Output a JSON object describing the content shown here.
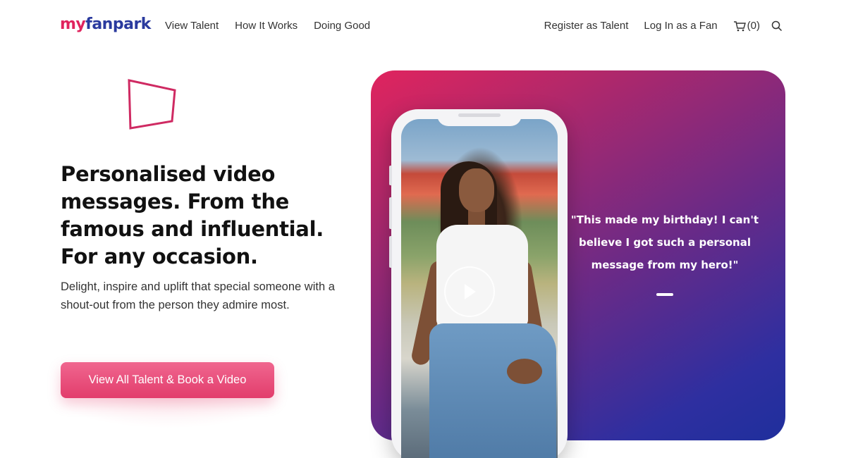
{
  "header": {
    "logo": {
      "part1": "my",
      "part2": "fanpark"
    },
    "nav_left": [
      {
        "label": "View Talent"
      },
      {
        "label": "How It Works"
      },
      {
        "label": "Doing Good"
      }
    ],
    "nav_right": [
      {
        "label": "Register as Talent"
      },
      {
        "label": "Log In as a Fan"
      }
    ],
    "cart": {
      "icon": "cart-icon",
      "label": "(0)"
    },
    "search": {
      "icon": "search-icon"
    }
  },
  "hero": {
    "title": "Personalised video messages. From the famous and influential. For any occasion.",
    "subtitle": "Delight, inspire and uplift that special someone with a shout-out from the person they admire most.",
    "cta_label": "View All Talent & Book a Video"
  },
  "showcase": {
    "quote": "\"This made my birthday! I can't believe I got such a personal message from my hero!\"",
    "play_icon": "play-icon"
  },
  "colors": {
    "brand_pink": "#e0245e",
    "brand_blue": "#2a3a9e",
    "gradient_start": "#e0245e",
    "gradient_end": "#1f2f9c"
  }
}
